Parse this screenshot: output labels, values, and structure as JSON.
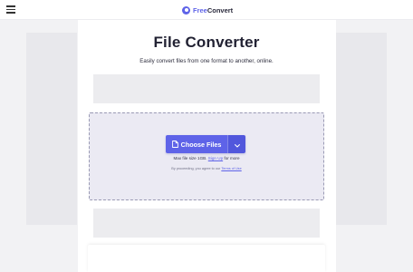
{
  "header": {
    "brand_free": "Free",
    "brand_convert": "Convert"
  },
  "main": {
    "title": "File Converter",
    "subtitle": "Easily convert files from one format to another, online."
  },
  "upload": {
    "choose_label": "Choose Files",
    "max_size_text": "Max file size 1GB.",
    "signup_link": "Sign Up",
    "max_size_suffix": "for more",
    "terms_prefix": "By proceeding, you agree to our",
    "terms_link": "Terms of Use"
  },
  "colors": {
    "accent": "#5e63e8",
    "dropzone_bg": "#ebeaf3",
    "page_bg": "#f2f2f4"
  }
}
